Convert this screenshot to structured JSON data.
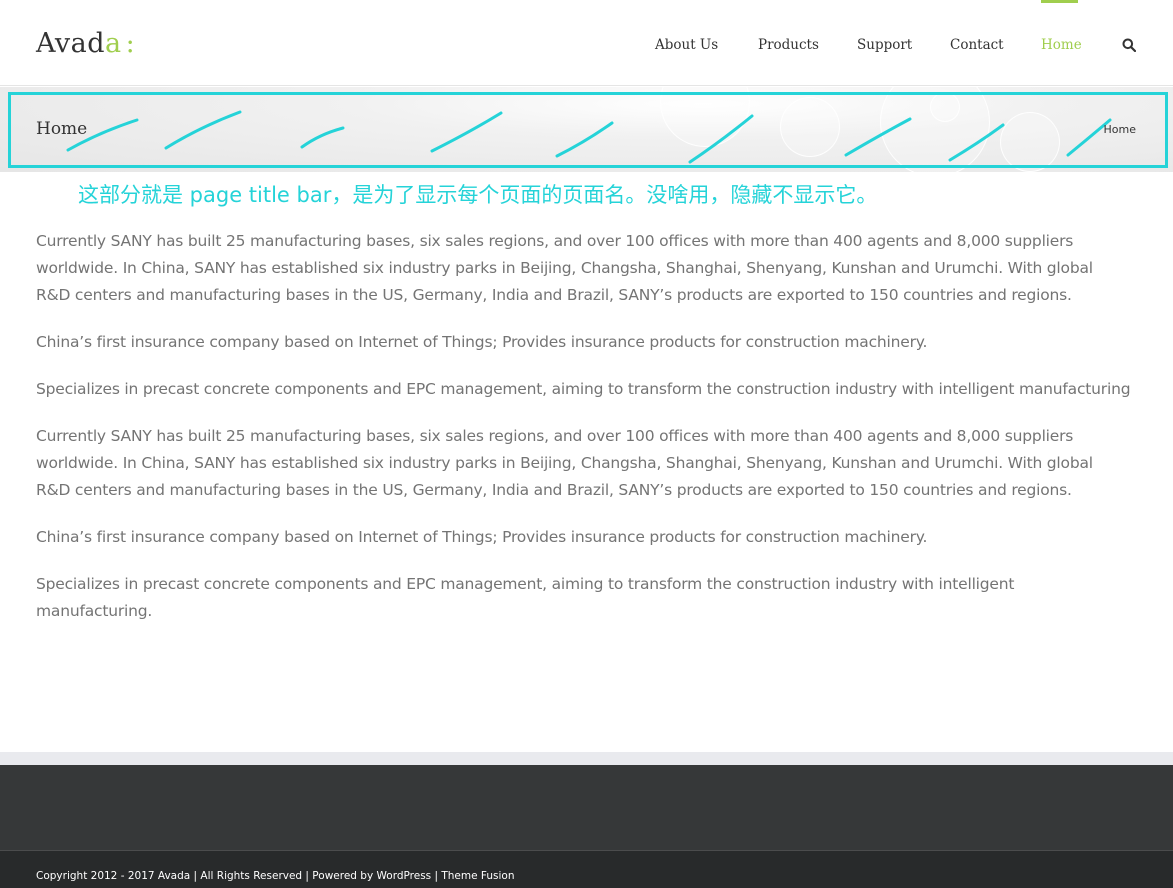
{
  "header": {
    "logo_text": "Avada",
    "logo_accent": "a",
    "logo_suffix": ":",
    "nav": [
      "About Us",
      "Products",
      "Support",
      "Contact",
      "Home"
    ],
    "active_nav": "Home",
    "search_icon": "search-icon"
  },
  "page_title_bar": {
    "title": "Home",
    "breadcrumb": "Home"
  },
  "annotation": {
    "text": "这部分就是 page title bar，是为了显示每个页面的页面名。没啥用，隐藏不显示它。"
  },
  "content": {
    "paragraphs": [
      "Currently SANY has built 25 manufacturing bases, six sales regions, and over 100 offices with more than 400 agents and 8,000 suppliers worldwide. In China, SANY has established six industry parks in Beijing, Changsha, Shanghai, Shenyang, Kunshan and Urumchi. With global R&D centers and manufacturing bases in the US, Germany, India and Brazil, SANY’s products are exported to 150 countries and regions.",
      "China’s first insurance company based on Internet of Things; Provides insurance products for construction machinery.",
      "Specializes in precast concrete components and EPC management, aiming to transform the construction industry with intelligent manufacturing",
      "Currently SANY has built 25 manufacturing bases, six sales regions, and over 100 offices with more than 400 agents and 8,000 suppliers worldwide. In China, SANY has established six industry parks in Beijing, Changsha, Shanghai, Shenyang, Kunshan and Urumchi. With global R&D centers and manufacturing bases in the US, Germany, India and Brazil, SANY’s products are exported to 150 countries and regions.",
      "China’s first insurance company based on Internet of Things; Provides insurance products for construction machinery.",
      "Specializes in precast concrete components and EPC management, aiming to transform the construction industry with intelligent manufacturing."
    ]
  },
  "footer": {
    "copyright": "Copyright 2012 - 2017 Avada | All Rights Reserved | Powered by WordPress | Theme Fusion"
  },
  "colors": {
    "accent": "#a0ce4e",
    "annotation": "#25d3d8",
    "footer_widgets": "#363839",
    "footer_copyright": "#282a2b"
  }
}
